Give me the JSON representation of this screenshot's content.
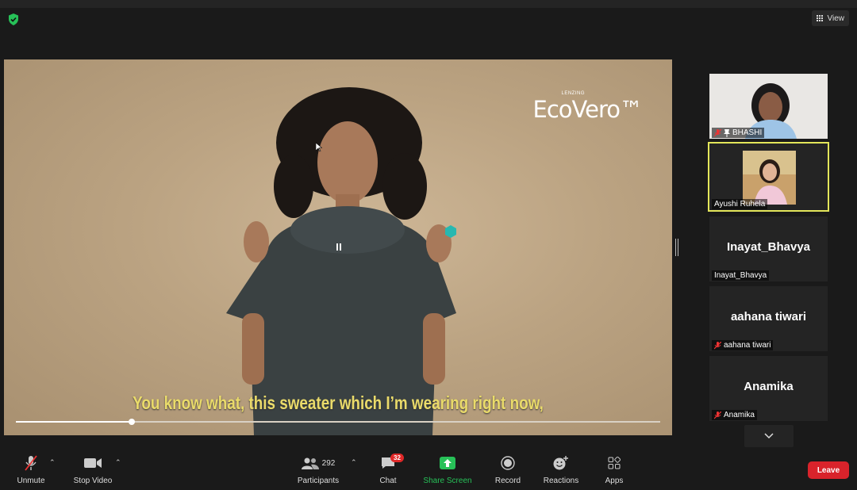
{
  "header": {
    "view_label": "View"
  },
  "video": {
    "logo_small": "LENZING",
    "logo_big": "EcoVero™",
    "subtitle": "You know what, this sweater which I’m wearing right now,",
    "progress_fraction": 0.18
  },
  "participants": [
    {
      "name": "BHASHI",
      "muted": true,
      "pinned": true
    },
    {
      "name": "Ayushi Ruhela",
      "muted": false,
      "active": true
    },
    {
      "name": "Inayat_Bhavya",
      "display": "Inayat_Bhavya",
      "muted": false
    },
    {
      "name": "aahana tiwari",
      "display": "aahana tiwari",
      "muted": true
    },
    {
      "name": "Anamika",
      "display": "Anamika",
      "muted": true
    }
  ],
  "toolbar": {
    "unmute": "Unmute",
    "stop_video": "Stop Video",
    "participants": "Participants",
    "participants_count": "292",
    "chat": "Chat",
    "chat_badge": "32",
    "share_screen": "Share Screen",
    "record": "Record",
    "reactions": "Reactions",
    "apps": "Apps",
    "leave": "Leave"
  },
  "colors": {
    "share_green": "#27c158",
    "leave_red": "#d9232b",
    "active_border": "#e3e65a",
    "subtitle_yellow": "#eadb6a"
  }
}
